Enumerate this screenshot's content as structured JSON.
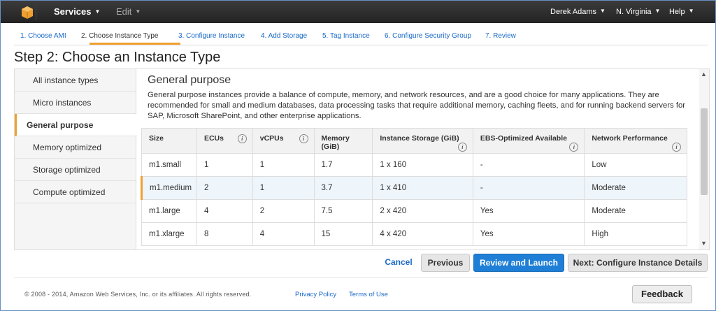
{
  "topnav": {
    "services_label": "Services",
    "edit_label": "Edit",
    "user_label": "Derek Adams",
    "region_label": "N. Virginia",
    "help_label": "Help"
  },
  "steps": [
    {
      "label": "1. Choose AMI"
    },
    {
      "label": "2. Choose Instance Type"
    },
    {
      "label": "3. Configure Instance"
    },
    {
      "label": "4. Add Storage"
    },
    {
      "label": "5. Tag Instance"
    },
    {
      "label": "6. Configure Security Group"
    },
    {
      "label": "7. Review"
    }
  ],
  "page_title": "Step 2: Choose an Instance Type",
  "sidebar": {
    "items": [
      {
        "label": "All instance types"
      },
      {
        "label": "Micro instances"
      },
      {
        "label": "General purpose"
      },
      {
        "label": "Memory optimized"
      },
      {
        "label": "Storage optimized"
      },
      {
        "label": "Compute optimized"
      }
    ],
    "active_index": 2
  },
  "section": {
    "title": "General purpose",
    "description": "General purpose instances provide a balance of compute, memory, and network resources, and are a good choice for many applications. They are recommended for small and medium databases, data processing tasks that require additional memory, caching fleets, and for running backend servers for SAP, Microsoft SharePoint, and other enterprise applications."
  },
  "table": {
    "headers": [
      {
        "label": "Size"
      },
      {
        "label": "ECUs"
      },
      {
        "label": "vCPUs"
      },
      {
        "label": "Memory (GiB)"
      },
      {
        "label": "Instance Storage (GiB)"
      },
      {
        "label": "EBS-Optimized Available"
      },
      {
        "label": "Network Performance"
      }
    ],
    "info_glyph": "i",
    "rows": [
      {
        "cells": [
          "m1.small",
          "1",
          "1",
          "1.7",
          "1 x 160",
          "-",
          "Low"
        ]
      },
      {
        "cells": [
          "m1.medium",
          "2",
          "1",
          "3.7",
          "1 x 410",
          "-",
          "Moderate"
        ]
      },
      {
        "cells": [
          "m1.large",
          "4",
          "2",
          "7.5",
          "2 x 420",
          "Yes",
          "Moderate"
        ]
      },
      {
        "cells": [
          "m1.xlarge",
          "8",
          "4",
          "15",
          "4 x 420",
          "Yes",
          "High"
        ]
      }
    ],
    "selected_row": 1
  },
  "buttons": {
    "cancel": "Cancel",
    "previous": "Previous",
    "review_launch": "Review and Launch",
    "next": "Next: Configure Instance Details"
  },
  "footer": {
    "copyright": "© 2008 - 2014, Amazon Web Services, Inc. or its affiliates. All rights reserved.",
    "privacy": "Privacy Policy",
    "terms": "Terms of Use",
    "feedback": "Feedback"
  },
  "colors": {
    "accent": "#f0a030",
    "link": "#1b6ac9",
    "primary_button": "#1f7fd6",
    "topnav": "#232323"
  },
  "icons": {
    "logo": "aws-cube-icon",
    "info": "info-icon",
    "dropdown": "caret-down-icon"
  }
}
